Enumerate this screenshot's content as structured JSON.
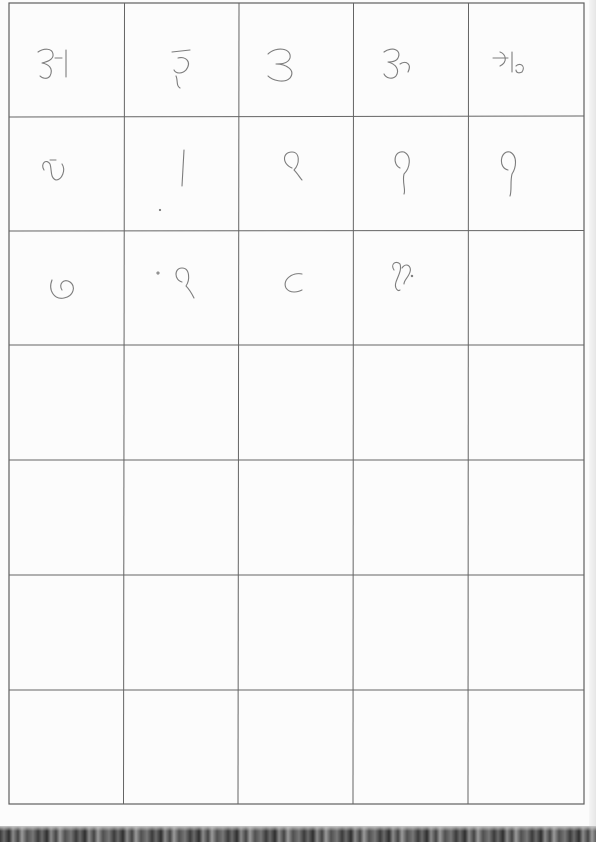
{
  "worksheet": {
    "columns": 5,
    "rows": 7,
    "cells": [
      {
        "row": 0,
        "col": 0,
        "glyph": "aa-vowel-sign"
      },
      {
        "row": 0,
        "col": 1,
        "glyph": "u-hook"
      },
      {
        "row": 0,
        "col": 2,
        "glyph": "three"
      },
      {
        "row": 0,
        "col": 3,
        "glyph": "three-hook"
      },
      {
        "row": 0,
        "col": 4,
        "glyph": "conjunct"
      },
      {
        "row": 1,
        "col": 0,
        "glyph": "loop-v"
      },
      {
        "row": 1,
        "col": 1,
        "glyph": "vertical-stroke"
      },
      {
        "row": 1,
        "col": 2,
        "glyph": "nine-loop"
      },
      {
        "row": 1,
        "col": 3,
        "glyph": "nine-tail"
      },
      {
        "row": 1,
        "col": 4,
        "glyph": "nine-long"
      },
      {
        "row": 2,
        "col": 0,
        "glyph": "six-curl"
      },
      {
        "row": 2,
        "col": 1,
        "glyph": "nine-small"
      },
      {
        "row": 2,
        "col": 2,
        "glyph": "c-curve"
      },
      {
        "row": 2,
        "col": 3,
        "glyph": "double-loop"
      }
    ]
  },
  "colors": {
    "ink": "#7c7c7c",
    "grid_line": "#5a5a5a",
    "paper": "#fcfcfc"
  }
}
